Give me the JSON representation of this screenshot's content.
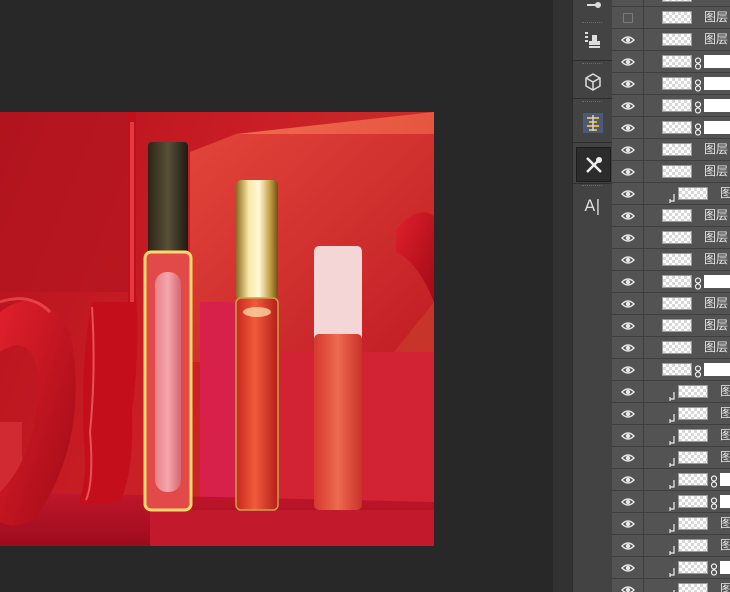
{
  "layers_panel": {
    "layer_name": "图层",
    "rows": [
      {
        "visible": false
      },
      {
        "visible": false,
        "hidden_box": true
      },
      {
        "visible": true
      },
      {
        "visible": true
      },
      {
        "visible": true
      },
      {
        "visible": true
      },
      {
        "visible": true
      },
      {
        "visible": true
      },
      {
        "visible": true
      },
      {
        "visible": true
      },
      {
        "visible": true
      },
      {
        "visible": true
      },
      {
        "visible": true
      },
      {
        "visible": true
      },
      {
        "visible": true
      },
      {
        "visible": true
      },
      {
        "visible": true
      },
      {
        "visible": true
      },
      {
        "visible": true
      },
      {
        "visible": true
      },
      {
        "visible": true
      },
      {
        "visible": true
      },
      {
        "visible": true
      },
      {
        "visible": true
      },
      {
        "visible": true
      },
      {
        "visible": true
      },
      {
        "visible": true
      },
      {
        "visible": true
      }
    ]
  },
  "tools": [
    {
      "icon": "brush-preset-icon"
    },
    {
      "icon": "clone-source-icon"
    },
    {
      "icon": "3d-cube-icon"
    },
    {
      "icon": "char-style-icon"
    },
    {
      "icon": "tool-presets-icon"
    },
    {
      "icon": "character-icon",
      "label": "A|"
    }
  ],
  "colors": {
    "canvas_bg": "#282828",
    "panel_bg": "#535353",
    "toolstrip_bg": "#434343"
  }
}
